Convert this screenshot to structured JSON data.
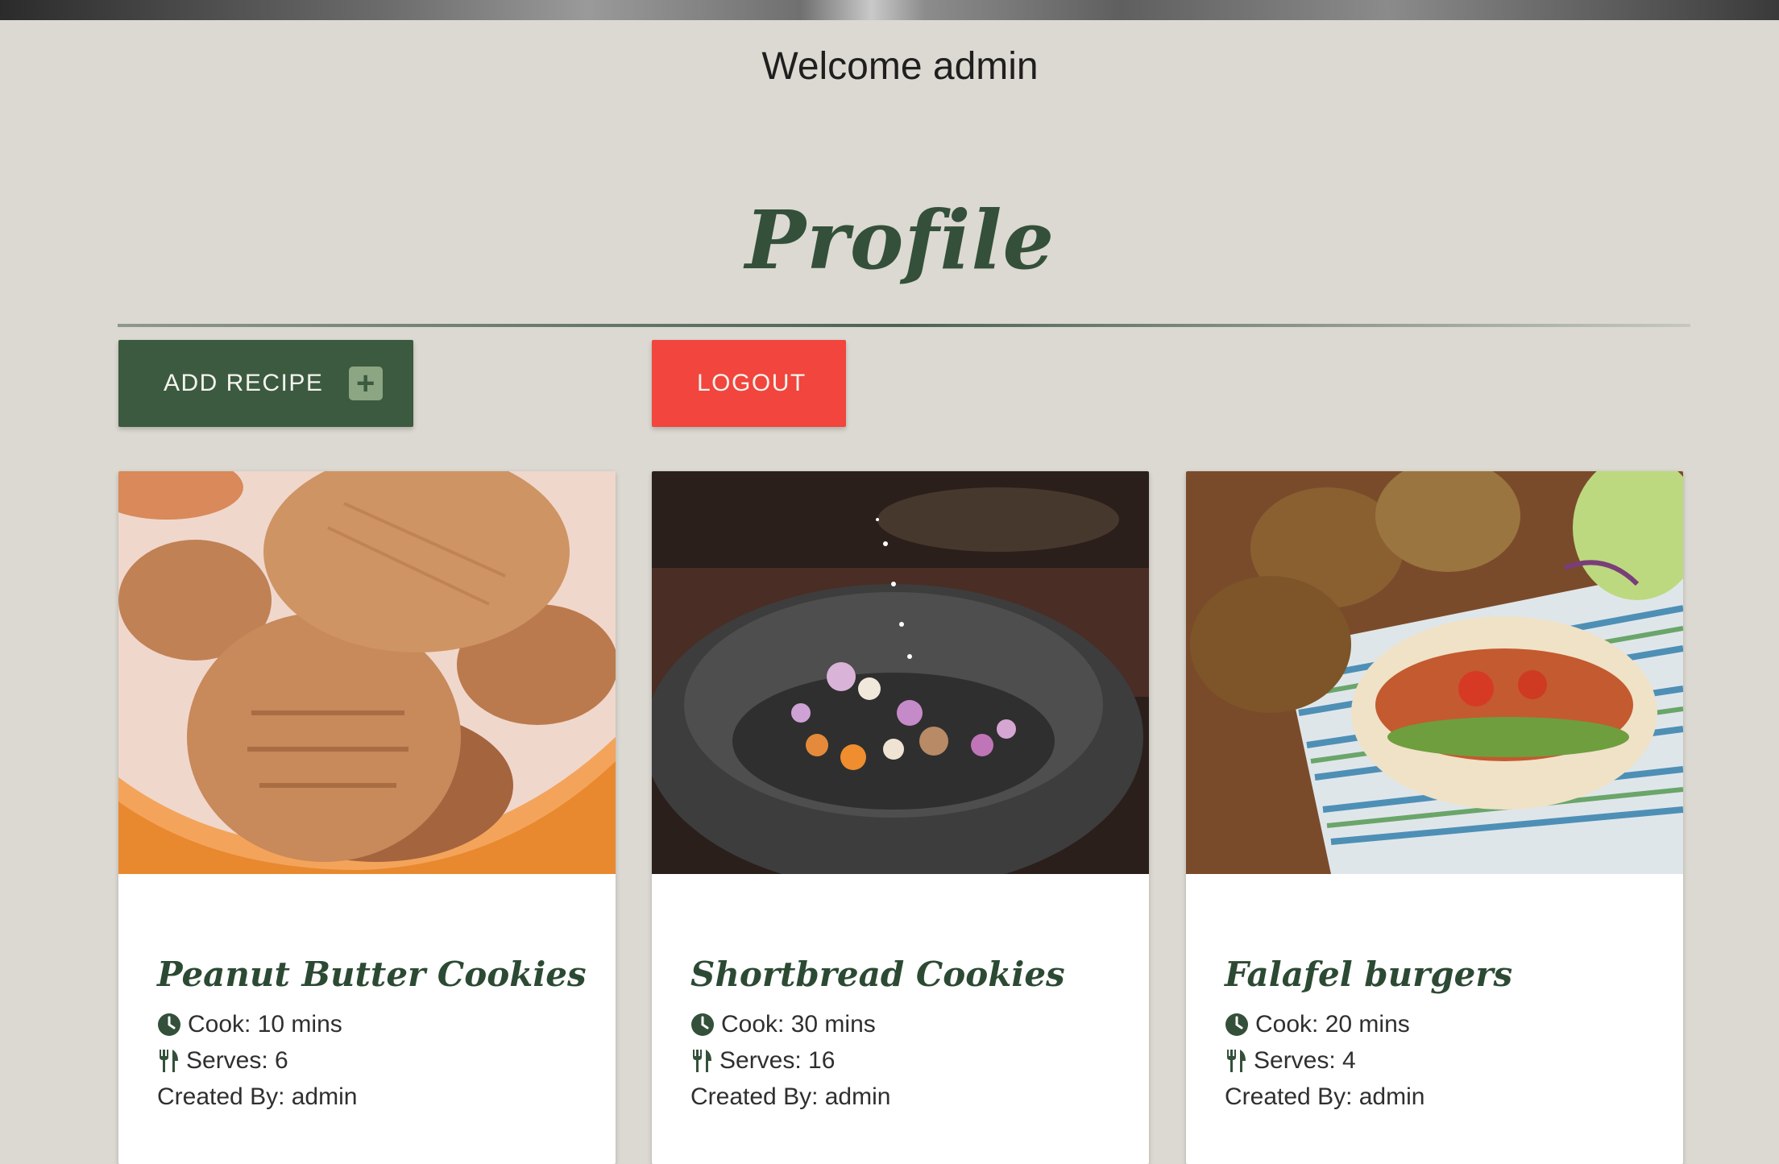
{
  "header": {
    "welcome_text": "Welcome admin"
  },
  "page": {
    "title": "Profile"
  },
  "actions": {
    "add_recipe_label": "ADD RECIPE",
    "logout_label": "LOGOUT"
  },
  "colors": {
    "primary": "#3c5a40",
    "danger": "#f1453d",
    "background": "#dbd9d1",
    "title": "#34503a"
  },
  "recipes": [
    {
      "title": "Peanut Butter Cookies",
      "cook": "Cook: 10 mins",
      "serves": "Serves: 6",
      "created_by": "Created By: admin"
    },
    {
      "title": "Shortbread Cookies",
      "cook": "Cook: 30 mins",
      "serves": "Serves: 16",
      "created_by": "Created By: admin"
    },
    {
      "title": "Falafel burgers",
      "cook": "Cook: 20 mins",
      "serves": "Serves: 4",
      "created_by": "Created By: admin"
    }
  ],
  "icons": {
    "cook": "clock-icon",
    "serves": "utensils-icon",
    "add": "plus-icon"
  }
}
